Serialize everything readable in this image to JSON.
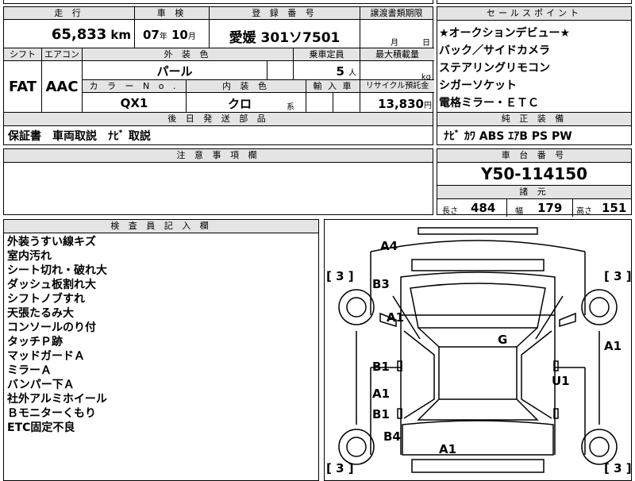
{
  "top": {
    "h_mileage": "走 行",
    "mileage": "65,833",
    "mileage_unit": "km",
    "h_inspection": "車 検",
    "insp_year": "07",
    "insp_year_unit": "年",
    "insp_month": "10",
    "insp_month_unit": "月",
    "h_reg": "登 録 番 号",
    "reg": "愛媛 301ソ7501",
    "h_transfer": "譲渡書類期限",
    "transfer_month": "月",
    "transfer_day": "日",
    "h_shift": "シフト",
    "shift": "FAT",
    "h_ac": "エアコン",
    "ac": "AAC",
    "h_exterior": "外 装 色",
    "exterior": "パール",
    "h_capacity": "乗車定員",
    "capacity": "5",
    "capacity_unit": "人",
    "h_load": "最大積載量",
    "load_unit": "kg",
    "h_color_no": "カ ラ ー N o .",
    "color_no": "QX1",
    "h_interior": "内 装 色",
    "interior": "クロ",
    "interior_unit": "系",
    "h_import": "輸 入 車",
    "h_recycle": "リサイクル預託金",
    "recycle": "13,830",
    "recycle_unit": "円",
    "h_later": "後 日 発 送 部 品",
    "later": "保証書　車両取説　ﾅﾋﾞ 取説",
    "h_notes": "注 意 事 項 欄"
  },
  "sales": {
    "header": "セールスポイント",
    "items": [
      "★オークションデビュー★",
      "バック／サイドカメラ",
      "ステアリングリモコン",
      "シガーソケット",
      "電格ミラー・ＥＴＣ"
    ]
  },
  "equipment": {
    "header": "純 正 装 備",
    "value": "ﾅﾋﾞ ｶﾜ ABS ｴｱB PS PW"
  },
  "chassis": {
    "header": "車 台 番 号",
    "value": "Y50-114150",
    "spec_header": "諸 元",
    "len_label": "長さ",
    "len": "484",
    "wid_label": "幅",
    "wid": "179",
    "hgt_label": "高さ",
    "hgt": "151"
  },
  "inspector": {
    "header": "検 査 員 記 入 欄",
    "items": [
      "外装うすい線キズ",
      "室内汚れ",
      "シート切れ・破れ大",
      "ダッシュ板割れ大",
      "シフトノブすれ",
      "天張たるみ大",
      "コンソールのり付",
      "タッチＰ跡",
      "マッドガードＡ",
      "ミラーＡ",
      "バンパー下Ａ",
      "社外アルミホイール",
      "Ｂモニターくもり",
      "ETC固定不良"
    ]
  },
  "diagram": {
    "tire_tl": "3",
    "tire_tr": "3",
    "tire_bl": "3",
    "tire_br": "3",
    "marks": [
      "A4",
      "B3",
      "A1",
      "B1",
      "A1",
      "B1",
      "B4",
      "A1",
      "G",
      "U1",
      "A1"
    ]
  }
}
